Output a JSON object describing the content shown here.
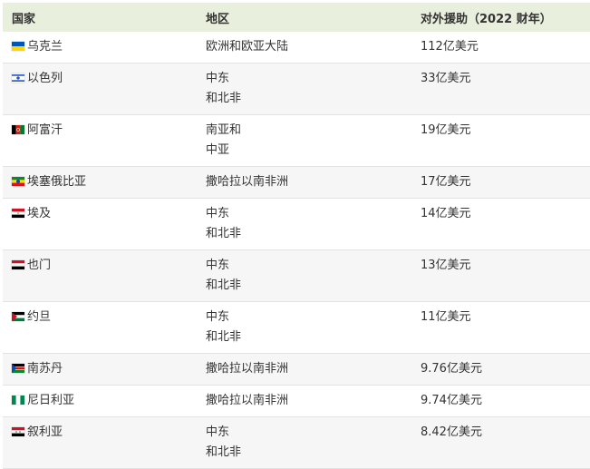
{
  "headers": {
    "country": "国家",
    "region": "地区",
    "aid": "对外援助（2022 财年）"
  },
  "rows": [
    {
      "country": "乌克兰",
      "flag_icon": "ukraine-flag-icon",
      "region": [
        "欧洲和欧亚大陆"
      ],
      "aid": "112亿美元"
    },
    {
      "country": "以色列",
      "flag_icon": "israel-flag-icon",
      "region": [
        "中东",
        "和北非"
      ],
      "aid": "33亿美元"
    },
    {
      "country": "阿富汗",
      "flag_icon": "afghanistan-flag-icon",
      "region": [
        "南亚和",
        "中亚"
      ],
      "aid": "19亿美元"
    },
    {
      "country": "埃塞俄比亚",
      "flag_icon": "ethiopia-flag-icon",
      "region": [
        "撒哈拉以南非洲"
      ],
      "aid": "17亿美元"
    },
    {
      "country": "埃及",
      "flag_icon": "egypt-flag-icon",
      "region": [
        "中东",
        "和北非"
      ],
      "aid": "14亿美元"
    },
    {
      "country": "也门",
      "flag_icon": "yemen-flag-icon",
      "region": [
        "中东",
        "和北非"
      ],
      "aid": "13亿美元"
    },
    {
      "country": "约旦",
      "flag_icon": "jordan-flag-icon",
      "region": [
        "中东",
        "和北非"
      ],
      "aid": "11亿美元"
    },
    {
      "country": "南苏丹",
      "flag_icon": "south-sudan-flag-icon",
      "region": [
        "撒哈拉以南非洲"
      ],
      "aid": "9.76亿美元"
    },
    {
      "country": "尼日利亚",
      "flag_icon": "nigeria-flag-icon",
      "region": [
        "撒哈拉以南非洲"
      ],
      "aid": "9.74亿美元"
    },
    {
      "country": "叙利亚",
      "flag_icon": "syria-flag-icon",
      "region": [
        "中东",
        "和北非"
      ],
      "aid": "8.42亿美元"
    }
  ],
  "colors": {
    "header_bg": "#e8efdd",
    "stripe_bg": "#f6f6f6",
    "text": "#333333"
  }
}
